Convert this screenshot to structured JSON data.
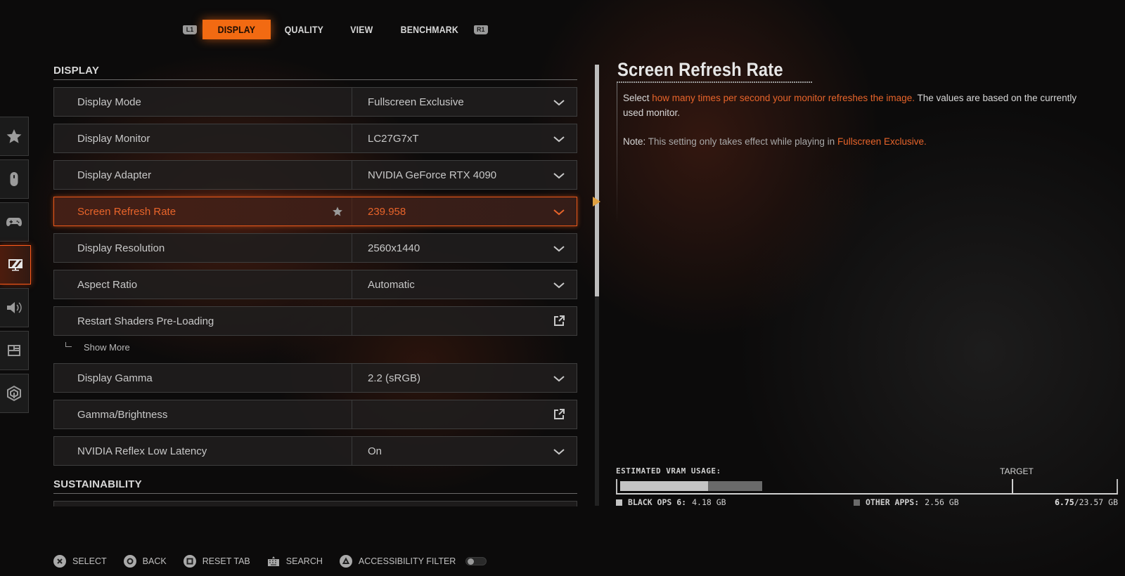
{
  "tabs": {
    "left_bumper": "L1",
    "right_bumper": "R1",
    "items": [
      {
        "label": "DISPLAY",
        "active": true
      },
      {
        "label": "QUALITY",
        "active": false
      },
      {
        "label": "VIEW",
        "active": false
      },
      {
        "label": "BENCHMARK",
        "active": false
      }
    ]
  },
  "sidebar": {
    "items": [
      {
        "icon": "star-icon",
        "active": false
      },
      {
        "icon": "mouse-icon",
        "active": false
      },
      {
        "icon": "gamepad-icon",
        "active": false
      },
      {
        "icon": "monitor-icon",
        "active": true
      },
      {
        "icon": "speaker-icon",
        "active": false
      },
      {
        "icon": "interface-icon",
        "active": false
      },
      {
        "icon": "network-icon",
        "active": false
      }
    ]
  },
  "sections": {
    "display": "DISPLAY",
    "sustainability": "SUSTAINABILITY"
  },
  "settings": [
    {
      "label": "Display Mode",
      "value": "Fullscreen Exclusive",
      "control": "dropdown"
    },
    {
      "label": "Display Monitor",
      "value": "LC27G7xT",
      "control": "dropdown"
    },
    {
      "label": "Display Adapter",
      "value": "NVIDIA GeForce RTX 4090",
      "control": "dropdown"
    },
    {
      "label": "Screen Refresh Rate",
      "value": "239.958",
      "control": "dropdown",
      "selected": true,
      "favorite_icon": "star-icon"
    },
    {
      "label": "Display Resolution",
      "value": "2560x1440",
      "control": "dropdown"
    },
    {
      "label": "Aspect Ratio",
      "value": "Automatic",
      "control": "dropdown"
    },
    {
      "label": "Restart Shaders Pre-Loading",
      "value": "",
      "control": "external"
    },
    {
      "label": "Display Gamma",
      "value": "2.2 (sRGB)",
      "control": "dropdown"
    },
    {
      "label": "Gamma/Brightness",
      "value": "",
      "control": "external"
    },
    {
      "label": "NVIDIA Reflex Low Latency",
      "value": "On",
      "control": "dropdown"
    }
  ],
  "show_more": "Show More",
  "description": {
    "title": "Screen Refresh Rate",
    "p1_pre": "Select ",
    "p1_highlight": "how many times per second your monitor refreshes the image.",
    "p1_post": " The values are based on the currently used monitor.",
    "note_label": "Note:",
    "note_text": " This setting only takes effect while playing in ",
    "note_highlight": "Fullscreen Exclusive",
    "note_end": "."
  },
  "vram": {
    "label": "ESTIMATED VRAM USAGE:",
    "target_label": "TARGET",
    "game_label": "BLACK OPS 6:",
    "game_value": "4.18 GB",
    "game_gb": 4.18,
    "other_label": "OTHER APPS:",
    "other_value": "2.56 GB",
    "other_gb": 2.56,
    "total_used": "6.75",
    "total_capacity": "/23.57 GB",
    "capacity_gb": 23.57,
    "target_fraction": 0.795,
    "game_color": "#c4c4c4",
    "other_color": "#6a6a6a"
  },
  "footer": [
    {
      "icon": "cross-button-icon",
      "label": "SELECT"
    },
    {
      "icon": "circle-button-icon",
      "label": "BACK"
    },
    {
      "icon": "square-button-icon",
      "label": "RESET TAB"
    },
    {
      "icon": "keyboard-icon",
      "label": "SEARCH"
    },
    {
      "icon": "triangle-button-icon",
      "label": "ACCESSIBILITY FILTER"
    }
  ],
  "accessibility_filter_on": false,
  "colors": {
    "accent": "#f26a12",
    "highlight_text": "#e8642a"
  }
}
